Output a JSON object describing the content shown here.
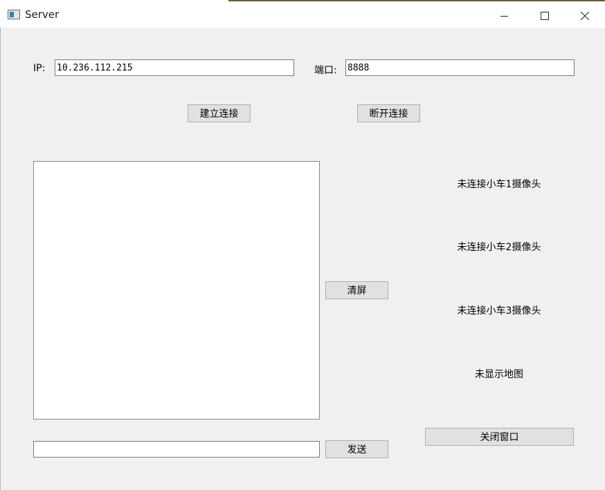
{
  "window": {
    "title": "Server",
    "minimize_icon": "minimize-icon",
    "maximize_icon": "maximize-icon",
    "close_icon": "close-icon"
  },
  "connection": {
    "ip_label": "IP:",
    "ip_value": "10.236.112.215",
    "port_label": "端口:",
    "port_value": "8888",
    "connect_label": "建立连接",
    "disconnect_label": "断开连接"
  },
  "log": {
    "clear_label": "清屏",
    "send_input_value": "",
    "send_label": "发送"
  },
  "status": {
    "camera1": "未连接小车1摄像头",
    "camera2": "未连接小车2摄像头",
    "camera3": "未连接小车3摄像头",
    "map": "未显示地图"
  },
  "close_window_label": "关闭窗口"
}
